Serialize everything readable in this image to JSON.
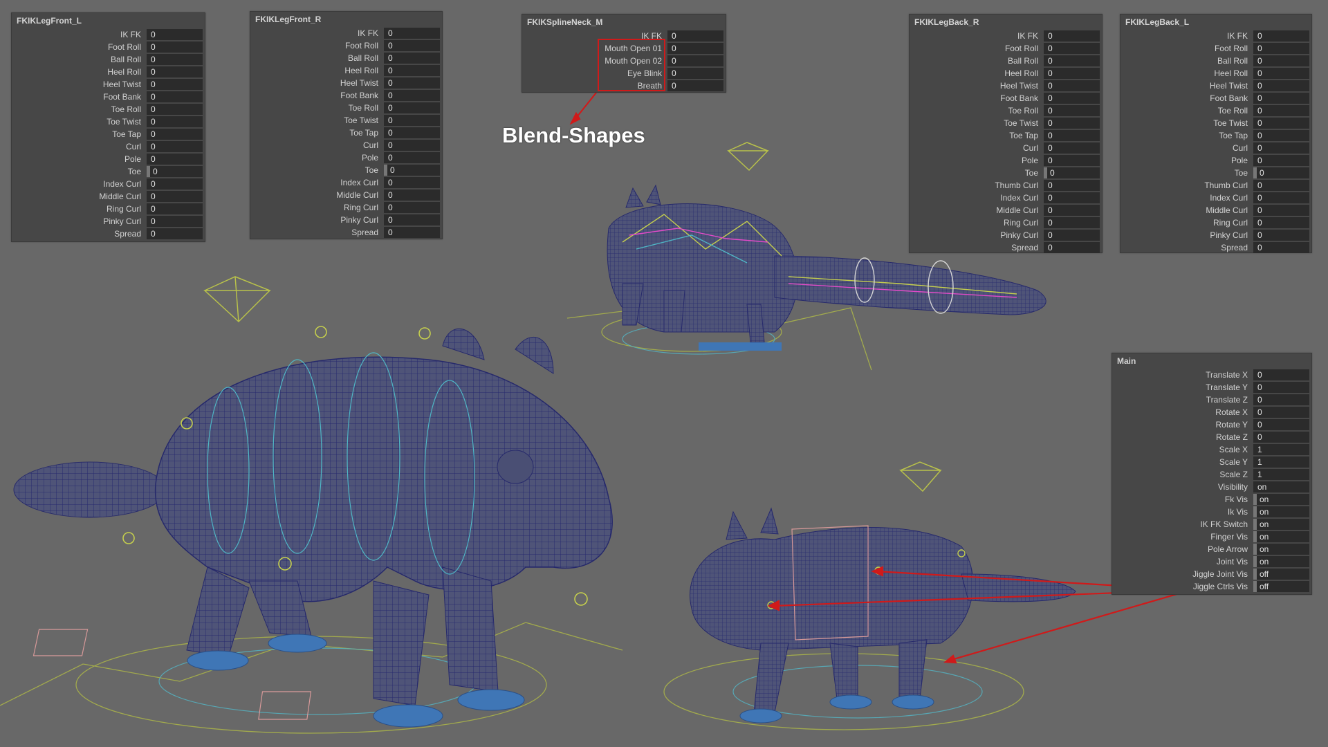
{
  "colors": {
    "viewport_bg": "#686868",
    "panel_bg": "#474747",
    "field_bg": "#2b2b2b",
    "annotation_red": "#d01a1a",
    "wireframe": "#2d2f7a",
    "controls_green": "#b9c24a",
    "controls_cyan": "#4fb7c6"
  },
  "panels": [
    {
      "title": "FKIKLegFront_L",
      "attrs": [
        {
          "label": "IK FK",
          "value": "0"
        },
        {
          "label": "Foot Roll",
          "value": "0"
        },
        {
          "label": "Ball Roll",
          "value": "0"
        },
        {
          "label": "Heel Roll",
          "value": "0"
        },
        {
          "label": "Heel Twist",
          "value": "0"
        },
        {
          "label": "Foot Bank",
          "value": "0"
        },
        {
          "label": "Toe Roll",
          "value": "0"
        },
        {
          "label": "Toe Twist",
          "value": "0"
        },
        {
          "label": "Toe Tap",
          "value": "0"
        },
        {
          "label": "Curl",
          "value": "0"
        },
        {
          "label": "Pole",
          "value": "0"
        },
        {
          "label": "Toe",
          "value": "0",
          "marker": true
        },
        {
          "label": "Index Curl",
          "value": "0"
        },
        {
          "label": "Middle Curl",
          "value": "0"
        },
        {
          "label": "Ring Curl",
          "value": "0"
        },
        {
          "label": "Pinky Curl",
          "value": "0"
        },
        {
          "label": "Spread",
          "value": "0"
        }
      ]
    },
    {
      "title": "FKIKLegFront_R",
      "attrs": [
        {
          "label": "IK FK",
          "value": "0"
        },
        {
          "label": "Foot Roll",
          "value": "0"
        },
        {
          "label": "Ball Roll",
          "value": "0"
        },
        {
          "label": "Heel Roll",
          "value": "0"
        },
        {
          "label": "Heel Twist",
          "value": "0"
        },
        {
          "label": "Foot Bank",
          "value": "0"
        },
        {
          "label": "Toe Roll",
          "value": "0"
        },
        {
          "label": "Toe Twist",
          "value": "0"
        },
        {
          "label": "Toe Tap",
          "value": "0"
        },
        {
          "label": "Curl",
          "value": "0"
        },
        {
          "label": "Pole",
          "value": "0"
        },
        {
          "label": "Toe",
          "value": "0",
          "marker": true
        },
        {
          "label": "Index Curl",
          "value": "0"
        },
        {
          "label": "Middle Curl",
          "value": "0"
        },
        {
          "label": "Ring Curl",
          "value": "0"
        },
        {
          "label": "Pinky Curl",
          "value": "0"
        },
        {
          "label": "Spread",
          "value": "0"
        }
      ]
    },
    {
      "title": "FKIKSplineNeck_M",
      "attrs": [
        {
          "label": "IK FK",
          "value": "0"
        },
        {
          "label": "Mouth Open 01",
          "value": "0"
        },
        {
          "label": "Mouth Open 02",
          "value": "0"
        },
        {
          "label": "Eye Blink",
          "value": "0"
        },
        {
          "label": "Breath",
          "value": "0"
        }
      ]
    },
    {
      "title": "FKIKLegBack_R",
      "attrs": [
        {
          "label": "IK FK",
          "value": "0"
        },
        {
          "label": "Foot Roll",
          "value": "0"
        },
        {
          "label": "Ball Roll",
          "value": "0"
        },
        {
          "label": "Heel Roll",
          "value": "0"
        },
        {
          "label": "Heel Twist",
          "value": "0"
        },
        {
          "label": "Foot Bank",
          "value": "0"
        },
        {
          "label": "Toe Roll",
          "value": "0"
        },
        {
          "label": "Toe Twist",
          "value": "0"
        },
        {
          "label": "Toe Tap",
          "value": "0"
        },
        {
          "label": "Curl",
          "value": "0"
        },
        {
          "label": "Pole",
          "value": "0"
        },
        {
          "label": "Toe",
          "value": "0",
          "marker": true
        },
        {
          "label": "Thumb Curl",
          "value": "0"
        },
        {
          "label": "Index Curl",
          "value": "0"
        },
        {
          "label": "Middle Curl",
          "value": "0"
        },
        {
          "label": "Ring Curl",
          "value": "0"
        },
        {
          "label": "Pinky Curl",
          "value": "0"
        },
        {
          "label": "Spread",
          "value": "0"
        }
      ]
    },
    {
      "title": "FKIKLegBack_L",
      "attrs": [
        {
          "label": "IK FK",
          "value": "0"
        },
        {
          "label": "Foot Roll",
          "value": "0"
        },
        {
          "label": "Ball Roll",
          "value": "0"
        },
        {
          "label": "Heel Roll",
          "value": "0"
        },
        {
          "label": "Heel Twist",
          "value": "0"
        },
        {
          "label": "Foot Bank",
          "value": "0"
        },
        {
          "label": "Toe Roll",
          "value": "0"
        },
        {
          "label": "Toe Twist",
          "value": "0"
        },
        {
          "label": "Toe Tap",
          "value": "0"
        },
        {
          "label": "Curl",
          "value": "0"
        },
        {
          "label": "Pole",
          "value": "0"
        },
        {
          "label": "Toe",
          "value": "0",
          "marker": true
        },
        {
          "label": "Thumb Curl",
          "value": "0"
        },
        {
          "label": "Index Curl",
          "value": "0"
        },
        {
          "label": "Middle Curl",
          "value": "0"
        },
        {
          "label": "Ring Curl",
          "value": "0"
        },
        {
          "label": "Pinky Curl",
          "value": "0"
        },
        {
          "label": "Spread",
          "value": "0"
        }
      ]
    },
    {
      "title": "Main",
      "attrs": [
        {
          "label": "Translate X",
          "value": "0"
        },
        {
          "label": "Translate Y",
          "value": "0"
        },
        {
          "label": "Translate Z",
          "value": "0"
        },
        {
          "label": "Rotate X",
          "value": "0"
        },
        {
          "label": "Rotate Y",
          "value": "0"
        },
        {
          "label": "Rotate Z",
          "value": "0"
        },
        {
          "label": "Scale X",
          "value": "1"
        },
        {
          "label": "Scale Y",
          "value": "1"
        },
        {
          "label": "Scale Z",
          "value": "1"
        },
        {
          "label": "Visibility",
          "value": "on"
        },
        {
          "label": "Fk Vis",
          "value": "on",
          "marker": true
        },
        {
          "label": "Ik Vis",
          "value": "on",
          "marker": true
        },
        {
          "label": "IK FK Switch",
          "value": "on",
          "marker": true
        },
        {
          "label": "Finger Vis",
          "value": "on",
          "marker": true
        },
        {
          "label": "Pole Arrow",
          "value": "on",
          "marker": true
        },
        {
          "label": "Joint Vis",
          "value": "on",
          "marker": true
        },
        {
          "label": "Jiggle Joint Vis",
          "value": "off",
          "marker": true
        },
        {
          "label": "Jiggle Ctrls Vis",
          "value": "off",
          "marker": true
        }
      ]
    }
  ],
  "annotation": {
    "label": "Blend-Shapes"
  }
}
